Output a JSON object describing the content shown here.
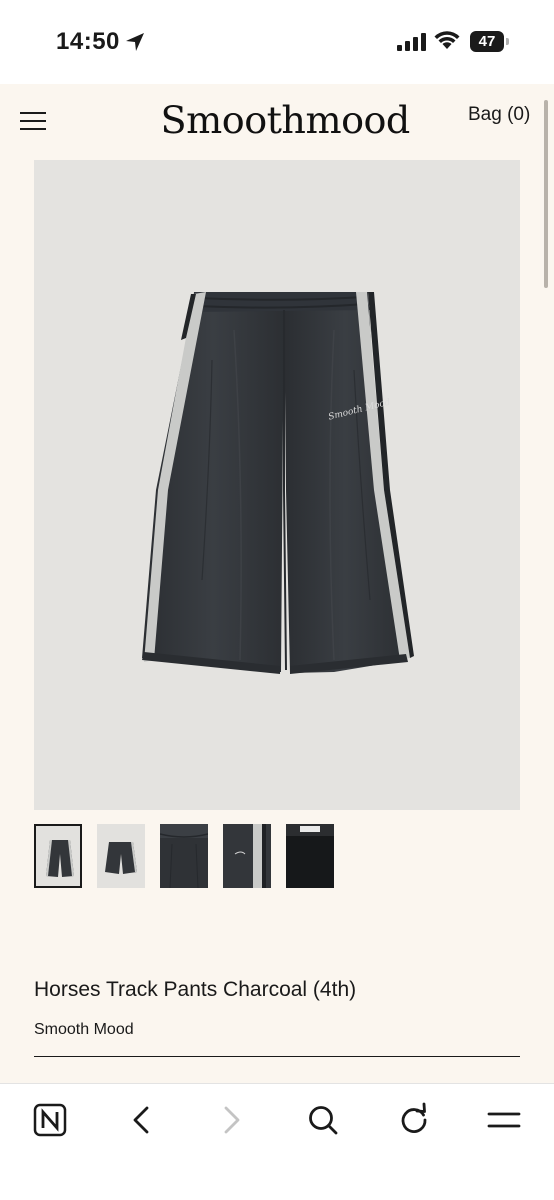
{
  "status_bar": {
    "time": "14:50",
    "battery": "47",
    "icons": [
      "location-arrow-icon",
      "cellular-signal-icon",
      "wifi-icon",
      "battery-icon"
    ]
  },
  "header": {
    "logo": "Smoothmood",
    "bag_label": "Bag (0)",
    "menu_icon": "hamburger-menu-icon"
  },
  "product_image": {
    "print_text": "Smooth Mood"
  },
  "gallery": {
    "thumbnail_count": 5,
    "active_index": 0
  },
  "product": {
    "title": "Horses Track Pants Charcoal (4th)",
    "brand": "Smooth Mood"
  },
  "browser_toolbar": {
    "icons": [
      "naver-n-icon",
      "back-arrow-icon",
      "forward-arrow-icon",
      "search-icon",
      "reload-icon",
      "menu-icon"
    ]
  },
  "colors": {
    "page_background": "#fbf6ef",
    "image_background": "#e4e3e0",
    "pants_charcoal": "#33363a",
    "stripe_silver": "#c9cac8"
  }
}
